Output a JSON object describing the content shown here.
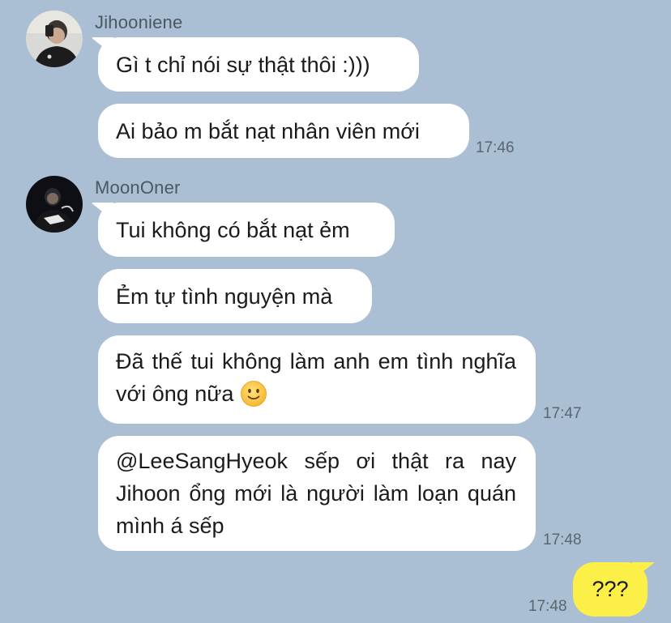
{
  "messages": {
    "group1": {
      "sender": "Jihooniene",
      "bubble1": "Gì t chỉ nói sự thật thôi :)))",
      "bubble2": "Ai bảo m bắt nạt nhân viên mới",
      "time": "17:46"
    },
    "group2": {
      "sender": "MoonOner",
      "bubble1": "Tui không có bắt nạt ẻm",
      "bubble2": "Ẻm tự tình nguyện mà",
      "bubble3": "Đã thế tui không làm anh em tình nghĩa với ông nữa",
      "bubble3_emoji": "slightly-smiling-face",
      "time3": "17:47",
      "bubble4": "@LeeSangHyeok sếp ơi thật ra nay Jihoon ổng mới là người làm loạn quán mình á sếp",
      "time4": "17:48"
    },
    "outgoing": {
      "text": "???",
      "time": "17:48"
    }
  },
  "colors": {
    "background": "#aabfd3",
    "incoming_bubble": "#ffffff",
    "outgoing_bubble": "#fcef48"
  }
}
